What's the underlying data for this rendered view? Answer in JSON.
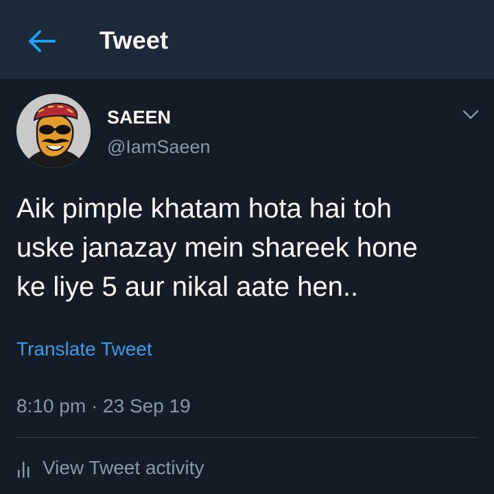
{
  "header": {
    "back_icon": "arrow-left-icon",
    "title": "Tweet",
    "accent_color": "#1da1f2"
  },
  "tweet": {
    "author": {
      "display_name": "SAEEN",
      "handle": "@IamSaeen",
      "avatar": "cartoon-man-avatar"
    },
    "menu_icon": "chevron-down-icon",
    "text_lines": [
      "Aik pimple khatam hota hai toh",
      "uske janazay mein shareek hone",
      "ke liye 5 aur nikal aate hen.."
    ],
    "translate_label": "Translate Tweet",
    "timestamp": "8:10 pm · 23 Sep 19",
    "activity_icon": "bar-chart-icon",
    "activity_label": "View Tweet activity"
  },
  "colors": {
    "background": "#141d26",
    "header_background": "#1c2938",
    "secondary_text": "#8899a6",
    "link": "#3d9be9"
  }
}
